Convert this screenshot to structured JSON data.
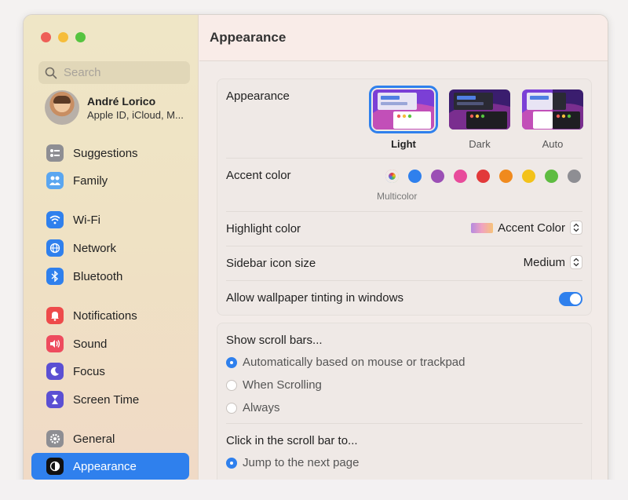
{
  "search": {
    "placeholder": "Search"
  },
  "profile": {
    "name": "André Lorico",
    "subtitle": "Apple ID, iCloud, M..."
  },
  "sidebar": {
    "items": [
      {
        "label": "Suggestions",
        "icon": "suggestions-icon",
        "color": "#8e8e93"
      },
      {
        "label": "Family",
        "icon": "family-icon",
        "color": "#5aa6f0"
      },
      {
        "label": "Wi-Fi",
        "icon": "wifi-icon",
        "color": "#2f80ed"
      },
      {
        "label": "Network",
        "icon": "network-icon",
        "color": "#2f80ed"
      },
      {
        "label": "Bluetooth",
        "icon": "bluetooth-icon",
        "color": "#2f80ed"
      },
      {
        "label": "Notifications",
        "icon": "notifications-icon",
        "color": "#ee4b4b"
      },
      {
        "label": "Sound",
        "icon": "sound-icon",
        "color": "#ee4b5e"
      },
      {
        "label": "Focus",
        "icon": "focus-icon",
        "color": "#5b4fd3"
      },
      {
        "label": "Screen Time",
        "icon": "screen-time-icon",
        "color": "#5b4fd3"
      },
      {
        "label": "General",
        "icon": "general-icon",
        "color": "#8e8e93"
      },
      {
        "label": "Appearance",
        "icon": "appearance-icon",
        "color": "#111111"
      }
    ]
  },
  "header": {
    "title": "Appearance"
  },
  "appearance": {
    "label": "Appearance",
    "options": [
      {
        "label": "Light",
        "selected": true
      },
      {
        "label": "Dark",
        "selected": false
      },
      {
        "label": "Auto",
        "selected": false
      }
    ]
  },
  "accent": {
    "label": "Accent color",
    "selected_label": "Multicolor",
    "colors": [
      "#2f80ed",
      "#9b4fb5",
      "#e84b9b",
      "#e2393a",
      "#f08a1e",
      "#f3c21a",
      "#5ebc41",
      "#8e8e93"
    ]
  },
  "highlight": {
    "label": "Highlight color",
    "value": "Accent Color"
  },
  "sidebar_icon_size": {
    "label": "Sidebar icon size",
    "value": "Medium"
  },
  "wallpaper_tinting": {
    "label": "Allow wallpaper tinting in windows",
    "on": true
  },
  "scroll_bars": {
    "title": "Show scroll bars...",
    "options": [
      {
        "label": "Automatically based on mouse or trackpad",
        "selected": true
      },
      {
        "label": "When Scrolling",
        "selected": false
      },
      {
        "label": "Always",
        "selected": false
      }
    ]
  },
  "click_scroll": {
    "title": "Click in the scroll bar to...",
    "options": [
      {
        "label": "Jump to the next page",
        "selected": true
      }
    ]
  }
}
